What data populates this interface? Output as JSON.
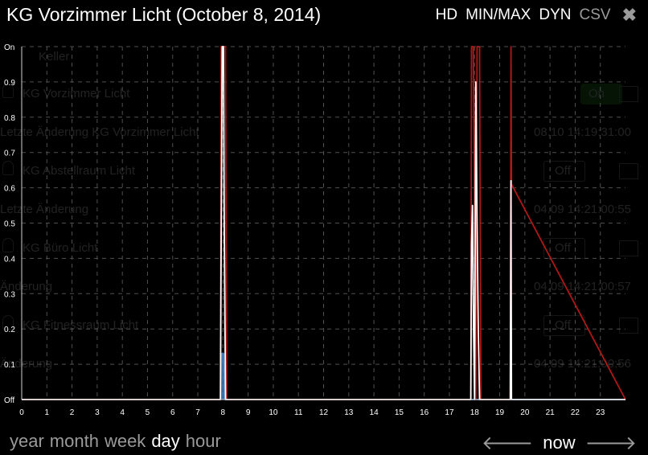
{
  "window": {
    "title": "KG Vorzimmer Licht (October 8, 2014)"
  },
  "toolbar": {
    "hd_label": "HD",
    "minmax_label": "MIN/MAX",
    "dyn_label": "DYN",
    "csv_label": "CSV",
    "close_icon": "close-icon"
  },
  "background": {
    "header_label": "Keller",
    "rows": [
      {
        "label": "KG Vorzimmer Licht",
        "value": "On"
      },
      {
        "label": "Letzte Änderung KG Vorzimmer Licht",
        "value": "08.10 14:19:31:00"
      },
      {
        "label": "KG Abstellraum Licht",
        "value": "Off"
      },
      {
        "label": "Letzte Änderung",
        "value": "04.09 14:21:00:55"
      },
      {
        "label": "KG Büro Licht",
        "value": "Off"
      },
      {
        "label": "Änderung",
        "value": "04.09 14:21:00:57"
      },
      {
        "label": "KG Fitnessraum Licht",
        "value": "Off"
      },
      {
        "label": "Änderung",
        "value": "04.09 14:21:00:56"
      }
    ]
  },
  "chart_data": {
    "type": "line",
    "x_ticks": [
      "0",
      "1",
      "2",
      "3",
      "4",
      "5",
      "6",
      "7",
      "8",
      "9",
      "10",
      "11",
      "12",
      "13",
      "14",
      "15",
      "16",
      "17",
      "18",
      "19",
      "20",
      "21",
      "22",
      "23"
    ],
    "y_ticks": [
      "Off",
      "0.1",
      "0.2",
      "0.3",
      "0.4",
      "0.5",
      "0.6",
      "0.7",
      "0.8",
      "0.9",
      "On"
    ],
    "xlim": [
      0,
      24
    ],
    "ylim": [
      0,
      1
    ],
    "grid": true,
    "colors": {
      "max": "#b01818",
      "avg": "#ffffff",
      "min": "#3d7fc2",
      "grid": "#505050",
      "axis": "#d0d0d0"
    },
    "series": [
      {
        "values": [
          [
            0,
            0
          ],
          [
            7.9,
            0
          ],
          [
            7.93,
            1
          ],
          [
            8.1,
            1
          ],
          [
            8.15,
            0
          ],
          [
            17.85,
            0
          ],
          [
            17.88,
            1
          ],
          [
            17.95,
            1
          ],
          [
            18.0,
            0.55
          ],
          [
            18.05,
            0
          ],
          [
            18.1,
            1
          ],
          [
            18.2,
            1
          ],
          [
            18.25,
            0
          ],
          [
            19.42,
            0
          ],
          [
            19.45,
            1
          ],
          [
            19.47,
            0.61
          ],
          [
            24,
            0
          ]
        ]
      },
      {
        "values": [
          [
            0,
            0
          ],
          [
            7.9,
            0
          ],
          [
            7.92,
            0.32
          ],
          [
            7.97,
            1
          ],
          [
            8.02,
            1
          ],
          [
            8.05,
            0.51
          ],
          [
            8.1,
            0
          ],
          [
            17.85,
            0
          ],
          [
            17.88,
            0.44
          ],
          [
            17.92,
            0.55
          ],
          [
            17.96,
            0.2
          ],
          [
            18.0,
            0
          ],
          [
            18.05,
            0.9
          ],
          [
            18.1,
            0.5
          ],
          [
            18.15,
            0.2
          ],
          [
            18.2,
            0
          ],
          [
            19.42,
            0
          ],
          [
            19.45,
            0.62
          ],
          [
            19.47,
            0
          ],
          [
            24,
            0
          ]
        ]
      },
      {
        "values": [
          [
            0,
            0
          ],
          [
            7.9,
            0
          ],
          [
            7.95,
            0.13
          ],
          [
            8.02,
            0.13
          ],
          [
            8.08,
            0
          ],
          [
            24,
            0
          ]
        ]
      }
    ]
  },
  "periods": {
    "year": "year",
    "month": "month",
    "week": "week",
    "day": "day",
    "hour": "hour"
  },
  "navigation": {
    "prev_icon": "arrow-left-icon",
    "now_label": "now",
    "next_icon": "arrow-right-icon"
  }
}
